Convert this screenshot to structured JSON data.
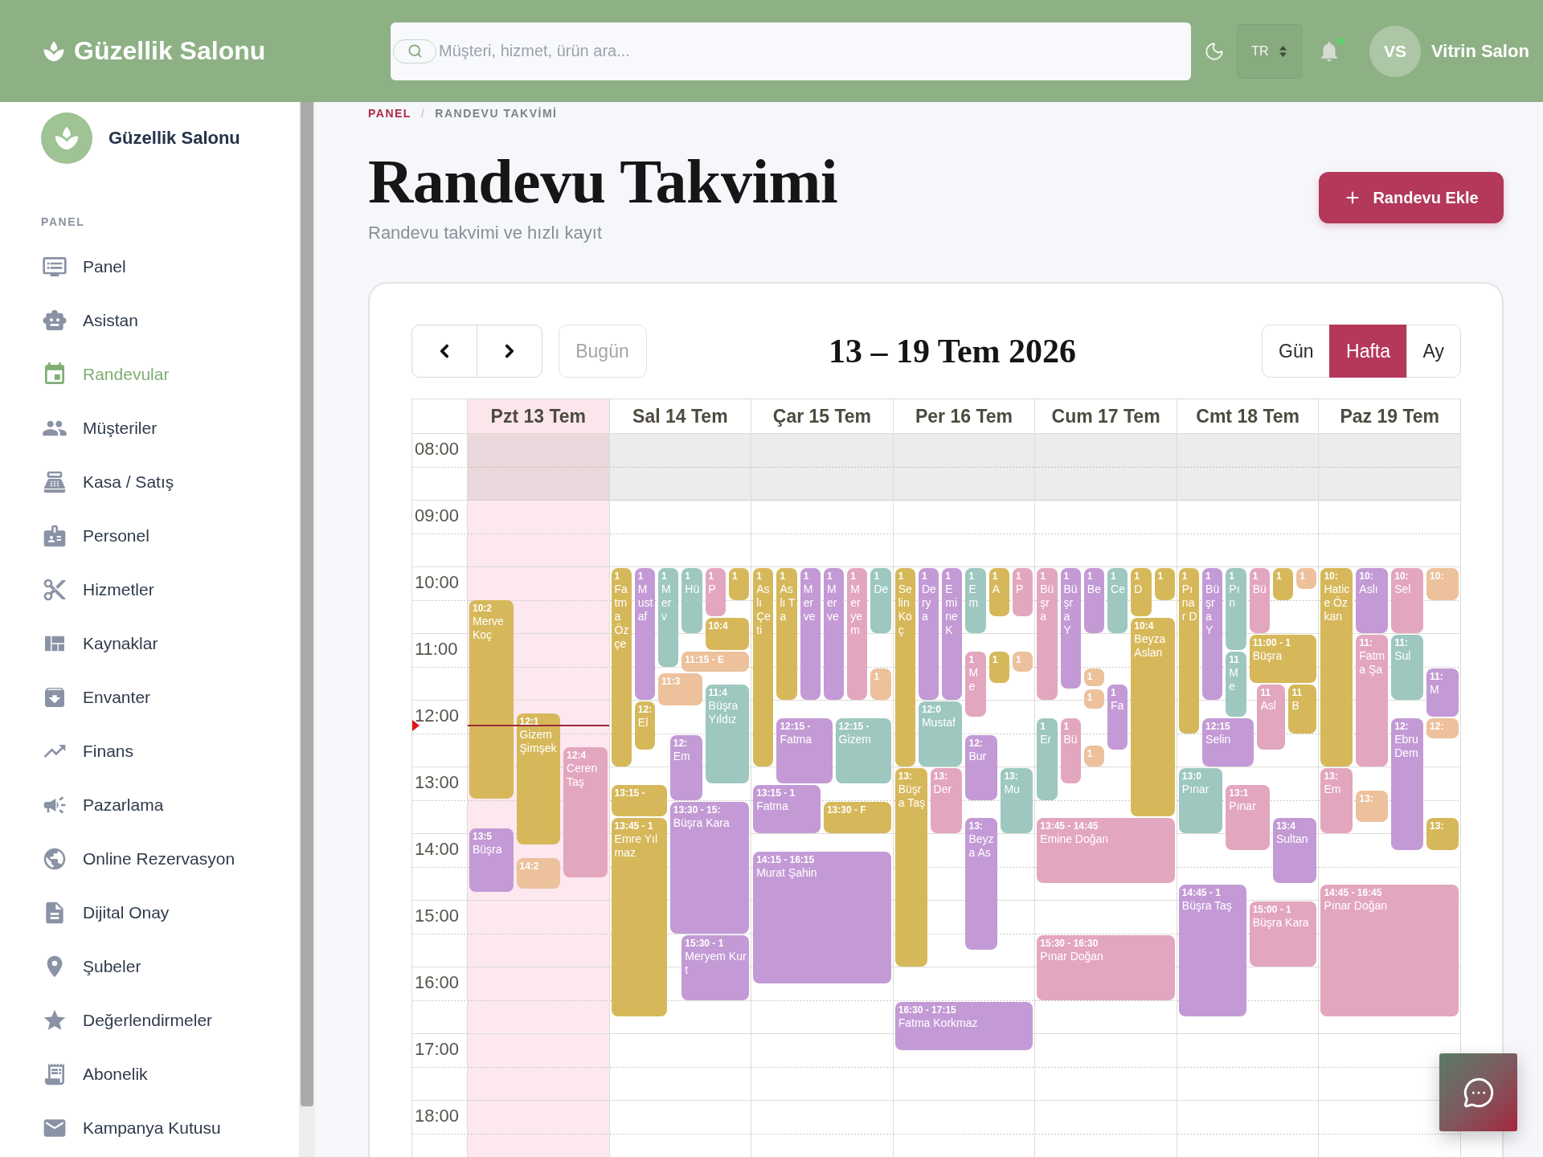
{
  "topbar": {
    "brand": "Güzellik Salonu",
    "search": {
      "placeholder": "Müşteri, hizmet, ürün ara..."
    },
    "language": "TR",
    "notifications": {
      "unread": true
    },
    "user": {
      "initials": "VS",
      "name": "Vitrin Salon"
    }
  },
  "sidebar": {
    "brand": "Güzellik Salonu",
    "section": "PANEL",
    "items": [
      {
        "label": "Panel",
        "selected": false
      },
      {
        "label": "Asistan",
        "selected": false
      },
      {
        "label": "Randevular",
        "selected": true
      },
      {
        "label": "Müşteriler",
        "selected": false
      },
      {
        "label": "Kasa / Satış",
        "selected": false
      },
      {
        "label": "Personel",
        "selected": false
      },
      {
        "label": "Hizmetler",
        "selected": false
      },
      {
        "label": "Kaynaklar",
        "selected": false
      },
      {
        "label": "Envanter",
        "selected": false
      },
      {
        "label": "Finans",
        "selected": false
      },
      {
        "label": "Pazarlama",
        "selected": false
      },
      {
        "label": "Online Rezervasyon",
        "selected": false
      },
      {
        "label": "Dijital Onay",
        "selected": false
      },
      {
        "label": "Şubeler",
        "selected": false
      },
      {
        "label": "Değerlendirmeler",
        "selected": false
      },
      {
        "label": "Abonelik",
        "selected": false
      },
      {
        "label": "Kampanya Kutusu",
        "selected": false
      }
    ]
  },
  "breadcrumb": {
    "separator": "/",
    "items": [
      {
        "label": "PANEL",
        "current": false
      },
      {
        "label": "RANDEVU TAKVİMİ",
        "current": true
      }
    ]
  },
  "page": {
    "title": "Randevu Takvimi",
    "subtitle": "Randevu takvimi ve hızlı kayıt",
    "add_button": "Randevu Ekle"
  },
  "calendar": {
    "title": "13 – 19 Tem 2026",
    "today_button": {
      "label": "Bugün",
      "disabled": true
    },
    "views": [
      {
        "label": "Gün",
        "selected": false
      },
      {
        "label": "Hafta",
        "selected": true
      },
      {
        "label": "Ay",
        "selected": false
      }
    ],
    "hours": [
      {
        "label": "08:00",
        "closed": true
      },
      {
        "label": "09:00",
        "closed": false
      },
      {
        "label": "10:00",
        "closed": false
      },
      {
        "label": "11:00",
        "closed": false
      },
      {
        "label": "12:00",
        "closed": false
      },
      {
        "label": "13:00",
        "closed": false
      },
      {
        "label": "14:00",
        "closed": false
      },
      {
        "label": "15:00",
        "closed": false
      },
      {
        "label": "16:00",
        "closed": false
      },
      {
        "label": "17:00",
        "closed": false
      },
      {
        "label": "18:00",
        "closed": false
      }
    ],
    "days": [
      {
        "label": "Pzt 13 Tem",
        "today": true,
        "events": [
          {
            "time": "10:2",
            "name": "Merve Koç",
            "color": "#d6b85a"
          },
          {
            "time": "12:1",
            "name": "Gizem Şimşek",
            "color": "#d6b85a"
          },
          {
            "time": "12:4",
            "name": "Ceren Taş",
            "color": "#e3a6bf"
          },
          {
            "time": "13:5",
            "name": "Büşra",
            "color": "#c39ad5"
          },
          {
            "time": "14:2",
            "color": "#ecc19c"
          }
        ]
      },
      {
        "label": "Sal 14 Tem",
        "today": false,
        "events": [
          {
            "time": "1",
            "name": "Fatma Özçe",
            "color": "#d6b85a"
          },
          {
            "time": "1",
            "name": "Mustaf",
            "color": "#c39ad5"
          },
          {
            "time": "1",
            "name": "Merv",
            "color": "#9dc7bf"
          },
          {
            "time": "1",
            "name": "Hü",
            "color": "#9dc7bf"
          },
          {
            "time": "1",
            "name": "P",
            "color": "#e3a6bf"
          },
          {
            "time": "1",
            "color": "#d6b85a"
          },
          {
            "time": "10:4",
            "color": "#d6b85a"
          },
          {
            "time": "11:15 - E",
            "color": "#ecc19c"
          },
          {
            "time": "11:3",
            "color": "#ecc19c"
          },
          {
            "time": "12:",
            "name": "El",
            "color": "#d6b85a"
          },
          {
            "time": "11:4",
            "name": "Büşra Yıldız",
            "color": "#9dc7bf"
          },
          {
            "time": "12:",
            "name": "Em",
            "color": "#c39ad5"
          },
          {
            "time": "13:15 -",
            "color": "#d6b85a"
          },
          {
            "time": "13:30 - 15:",
            "name": "Büşra Kara",
            "color": "#c39ad5"
          },
          {
            "time": "13:45 - 1",
            "name": "Emre Yılmaz",
            "color": "#d6b85a"
          },
          {
            "time": "15:30 - 1",
            "name": "Meryem Kurt",
            "color": "#c39ad5"
          }
        ]
      },
      {
        "label": "Çar 15 Tem",
        "today": false,
        "events": [
          {
            "time": "1",
            "name": "Aslı Çeti",
            "color": "#d6b85a"
          },
          {
            "time": "1",
            "name": "Aslı Ta",
            "color": "#d6b85a"
          },
          {
            "time": "1",
            "name": "Merve",
            "color": "#c39ad5"
          },
          {
            "time": "1",
            "name": "Merve",
            "color": "#c39ad5"
          },
          {
            "time": "1",
            "name": "Meryem",
            "color": "#e3a6bf"
          },
          {
            "time": "1",
            "name": "De",
            "color": "#9dc7bf"
          },
          {
            "time": "1",
            "color": "#ecc19c"
          },
          {
            "time": "12:15 -",
            "name": "Fatma",
            "color": "#c39ad5"
          },
          {
            "time": "12:15 -",
            "name": "Gizem",
            "color": "#9dc7bf"
          },
          {
            "time": "13:15 - 1",
            "name": "Fatma",
            "color": "#c39ad5"
          },
          {
            "time": "13:30 - F",
            "color": "#d6b85a"
          },
          {
            "time": "14:15 - 16:15",
            "name": "Murat Şahin",
            "color": "#c39ad5"
          }
        ]
      },
      {
        "label": "Per 16 Tem",
        "today": false,
        "events": [
          {
            "time": "1",
            "name": "Selin Koç",
            "color": "#d6b85a"
          },
          {
            "time": "1",
            "name": "Derya",
            "color": "#c39ad5"
          },
          {
            "time": "1",
            "name": "Emine K",
            "color": "#c39ad5"
          },
          {
            "time": "1",
            "name": "Em",
            "color": "#9dc7bf"
          },
          {
            "time": "1",
            "name": "A",
            "color": "#d6b85a"
          },
          {
            "time": "1",
            "name": "P",
            "color": "#e3a6bf"
          },
          {
            "time": "1",
            "name": "Me",
            "color": "#e3a6bf"
          },
          {
            "time": "1",
            "color": "#d6b85a"
          },
          {
            "time": "1",
            "color": "#ecc19c"
          },
          {
            "time": "12:0",
            "name": "Mustaf",
            "color": "#9dc7bf"
          },
          {
            "time": "12:",
            "name": "Bur",
            "color": "#c39ad5"
          },
          {
            "time": "13:",
            "name": "Büşra Taş",
            "color": "#d6b85a"
          },
          {
            "time": "13:",
            "name": "Der",
            "color": "#e3a6bf"
          },
          {
            "time": "13:",
            "name": "Mu",
            "color": "#9dc7bf"
          },
          {
            "time": "13:",
            "name": "Beyza As",
            "color": "#c39ad5"
          },
          {
            "time": "16:30 - 17:15",
            "name": "Fatma Korkmaz",
            "color": "#c39ad5"
          }
        ]
      },
      {
        "label": "Cum 17 Tem",
        "today": false,
        "events": [
          {
            "time": "1",
            "name": "Büşra",
            "color": "#e3a6bf"
          },
          {
            "time": "1",
            "name": "Büşra Y",
            "color": "#c39ad5"
          },
          {
            "time": "1",
            "name": "Be",
            "color": "#c39ad5"
          },
          {
            "time": "1",
            "name": "Ce",
            "color": "#9dc7bf"
          },
          {
            "time": "1",
            "name": "D",
            "color": "#d6b85a"
          },
          {
            "time": "1",
            "color": "#d6b85a"
          },
          {
            "time": "10:4",
            "name": "Beyza Aslan",
            "color": "#d6b85a"
          },
          {
            "time": "1",
            "color": "#ecc19c"
          },
          {
            "time": "1",
            "color": "#ecc19c"
          },
          {
            "time": "1",
            "name": "Fa",
            "color": "#c39ad5"
          },
          {
            "time": "1",
            "name": "Er",
            "color": "#9dc7bf"
          },
          {
            "time": "1",
            "name": "Bü",
            "color": "#e3a6bf"
          },
          {
            "time": "1",
            "color": "#ecc19c"
          },
          {
            "time": "13:45 - 14:45",
            "name": "Emine Doğan",
            "color": "#e3a6bf"
          },
          {
            "time": "15:30 - 16:30",
            "name": "Pınar Doğan",
            "color": "#e3a6bf"
          }
        ]
      },
      {
        "label": "Cmt 18 Tem",
        "today": false,
        "events": [
          {
            "time": "1",
            "name": "Pınar D",
            "color": "#d6b85a"
          },
          {
            "time": "1",
            "name": "Büşra Y",
            "color": "#c39ad5"
          },
          {
            "time": "1",
            "name": "Pın",
            "color": "#9dc7bf"
          },
          {
            "time": "1",
            "name": "Bü",
            "color": "#e3a6bf"
          },
          {
            "time": "1",
            "color": "#d6b85a"
          },
          {
            "time": "1",
            "color": "#ecc19c"
          },
          {
            "time": "11:00 - 1",
            "name": "Büşra",
            "color": "#d6b85a"
          },
          {
            "time": "11",
            "name": "Me",
            "color": "#9dc7bf"
          },
          {
            "time": "11",
            "name": "Asl",
            "color": "#e3a6bf"
          },
          {
            "time": "11",
            "name": "B",
            "color": "#d6b85a"
          },
          {
            "time": "12:15",
            "name": "Selin",
            "color": "#c39ad5"
          },
          {
            "time": "13:0",
            "name": "Pınar",
            "color": "#9dc7bf"
          },
          {
            "time": "13:1",
            "name": "Pınar",
            "color": "#e3a6bf"
          },
          {
            "time": "13:4",
            "name": "Sultan",
            "color": "#c39ad5"
          },
          {
            "time": "14:45 - 1",
            "name": "Büşra Taş",
            "color": "#c39ad5"
          },
          {
            "time": "15:00 - 1",
            "name": "Büşra Kara",
            "color": "#e3a6bf"
          }
        ]
      },
      {
        "label": "Paz 19 Tem",
        "today": false,
        "events": [
          {
            "time": "10:",
            "name": "Hatice Özkan",
            "color": "#d6b85a"
          },
          {
            "time": "10:",
            "name": "Aslı",
            "color": "#c39ad5"
          },
          {
            "time": "10:",
            "name": "Sel",
            "color": "#e3a6bf"
          },
          {
            "time": "10:",
            "color": "#ecc19c"
          },
          {
            "time": "11:",
            "name": "Fatma Şa",
            "color": "#e3a6bf"
          },
          {
            "time": "11:",
            "name": "Sul",
            "color": "#9dc7bf"
          },
          {
            "time": "11:",
            "name": "M",
            "color": "#c39ad5"
          },
          {
            "time": "12:",
            "color": "#ecc19c"
          },
          {
            "time": "12:",
            "name": "Ebru Dem",
            "color": "#c39ad5"
          },
          {
            "time": "13:",
            "name": "Em",
            "color": "#e3a6bf"
          },
          {
            "time": "13:",
            "color": "#ecc19c"
          },
          {
            "time": "13:",
            "color": "#d6b85a"
          },
          {
            "time": "14:45 - 16:45",
            "name": "Pınar Doğan",
            "color": "#e3a6bf"
          }
        ]
      }
    ]
  }
}
